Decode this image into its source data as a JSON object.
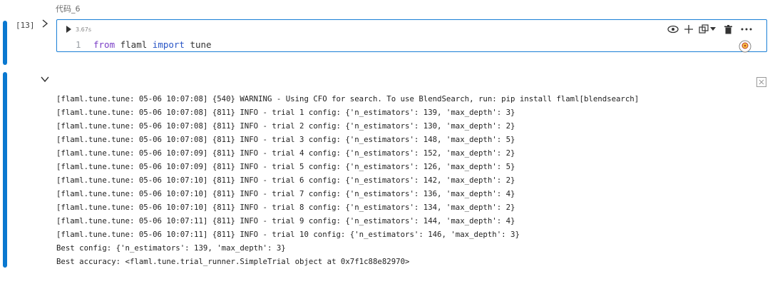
{
  "cell": {
    "title": "代码_6",
    "execution_count": "[13]",
    "execution_time": "3.67s",
    "line_number": "1",
    "code": {
      "kw_from": "from",
      "module": " flaml ",
      "kw_import": "import",
      "name": " tune"
    }
  },
  "toolbar": {
    "icons": [
      "eye-icon",
      "plus-icon",
      "copy-icon",
      "chevron-down-icon",
      "trash-icon",
      "more-icon"
    ]
  },
  "output": {
    "lines": [
      "[flaml.tune.tune: 05-06 10:07:08] {540} WARNING - Using CFO for search. To use BlendSearch, run: pip install flaml[blendsearch]",
      "[flaml.tune.tune: 05-06 10:07:08] {811} INFO - trial 1 config: {'n_estimators': 139, 'max_depth': 3}",
      "[flaml.tune.tune: 05-06 10:07:08] {811} INFO - trial 2 config: {'n_estimators': 130, 'max_depth': 2}",
      "[flaml.tune.tune: 05-06 10:07:08] {811} INFO - trial 3 config: {'n_estimators': 148, 'max_depth': 5}",
      "[flaml.tune.tune: 05-06 10:07:09] {811} INFO - trial 4 config: {'n_estimators': 152, 'max_depth': 2}",
      "[flaml.tune.tune: 05-06 10:07:09] {811} INFO - trial 5 config: {'n_estimators': 126, 'max_depth': 5}",
      "[flaml.tune.tune: 05-06 10:07:10] {811} INFO - trial 6 config: {'n_estimators': 142, 'max_depth': 2}",
      "[flaml.tune.tune: 05-06 10:07:10] {811} INFO - trial 7 config: {'n_estimators': 136, 'max_depth': 4}",
      "[flaml.tune.tune: 05-06 10:07:10] {811} INFO - trial 8 config: {'n_estimators': 134, 'max_depth': 2}",
      "[flaml.tune.tune: 05-06 10:07:11] {811} INFO - trial 9 config: {'n_estimators': 144, 'max_depth': 4}",
      "[flaml.tune.tune: 05-06 10:07:11] {811} INFO - trial 10 config: {'n_estimators': 146, 'max_depth': 3}",
      "Best config: {'n_estimators': 139, 'max_depth': 3}",
      "Best accuracy: <flaml.tune.trial_runner.SimpleTrial object at 0x7f1c88e82970>"
    ]
  },
  "colors": {
    "accent": "#0a78d0",
    "keyword_from": "#7a3ec6",
    "keyword_import": "#2a56c6"
  }
}
